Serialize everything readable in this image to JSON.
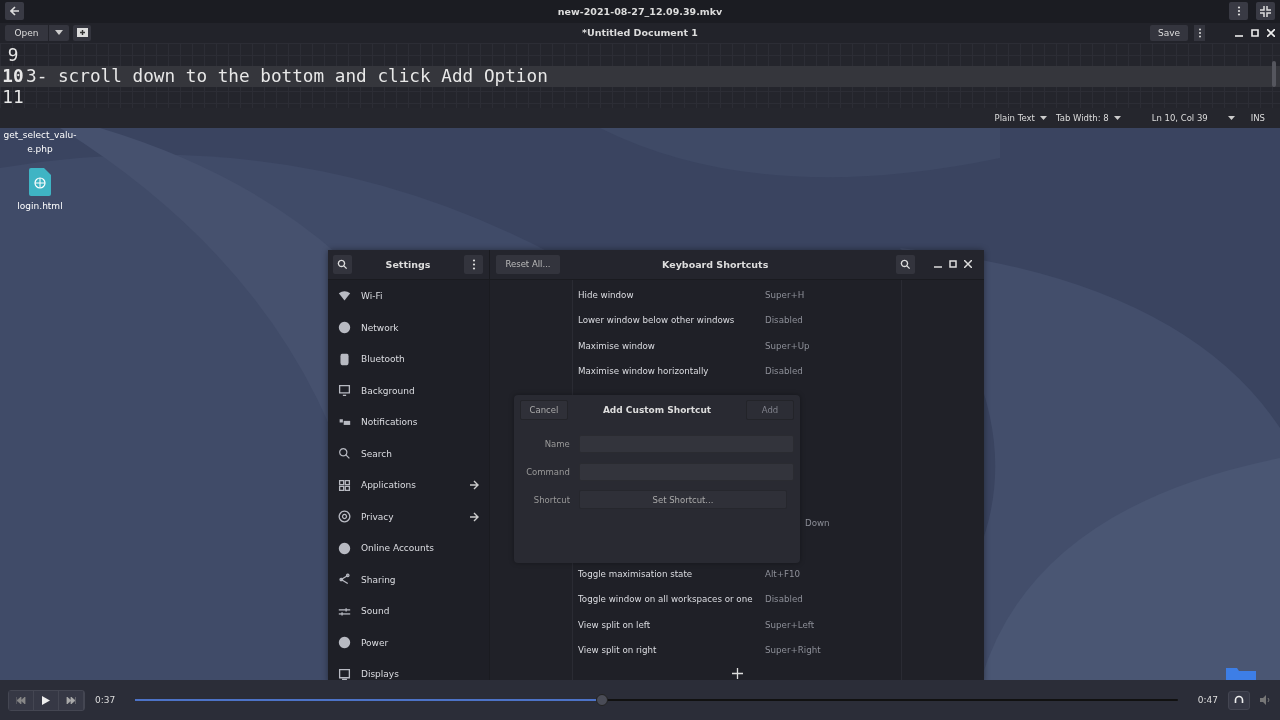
{
  "player": {
    "title": "new-2021-08-27_12.09.39.mkv",
    "current_time": "0:37",
    "total_time": "0:47",
    "level": 0.448
  },
  "editor": {
    "title": "*Untitled Document 1",
    "open_label": "Open",
    "save_label": "Save",
    "lines": [
      {
        "number": "9",
        "current": false
      },
      {
        "number": "10",
        "text": "3- scroll down to the bottom and click Add Option",
        "current": true
      },
      {
        "number": "11",
        "current": false
      }
    ],
    "status": {
      "language": "Plain Text",
      "tab_width": "Tab Width: 8",
      "position": "Ln 10, Col 39",
      "mode": "INS"
    }
  },
  "desktop_icons": [
    {
      "label": "get_select_valu-\ne.php",
      "kind": "text"
    },
    {
      "label": "login.html",
      "kind": "web"
    }
  ],
  "settings": {
    "title": "Settings",
    "reset_label": "Reset All...",
    "panel_title": "Keyboard Shortcuts",
    "sidebar": [
      {
        "label": "Wi-Fi",
        "submenu": false
      },
      {
        "label": "Network",
        "submenu": false
      },
      {
        "label": "Bluetooth",
        "submenu": false
      },
      {
        "label": "Background",
        "submenu": false
      },
      {
        "label": "Notifications",
        "submenu": false
      },
      {
        "label": "Search",
        "submenu": false
      },
      {
        "label": "Applications",
        "submenu": true
      },
      {
        "label": "Privacy",
        "submenu": true
      },
      {
        "label": "Online Accounts",
        "submenu": false
      },
      {
        "label": "Sharing",
        "submenu": false
      },
      {
        "label": "Sound",
        "submenu": false
      },
      {
        "label": "Power",
        "submenu": false
      },
      {
        "label": "Displays",
        "submenu": false
      }
    ],
    "shortcuts": [
      {
        "kind": "row",
        "name": "Hide window",
        "keys": "Super+H"
      },
      {
        "kind": "row",
        "name": "Lower window below other windows",
        "keys": "Disabled"
      },
      {
        "kind": "row",
        "name": "Maximise window",
        "keys": "Super+Up"
      },
      {
        "kind": "row",
        "name": "Maximise window horizontally",
        "keys": "Disabled"
      },
      {
        "kind": "covered"
      },
      {
        "kind": "covered"
      },
      {
        "kind": "covered"
      },
      {
        "kind": "covered"
      },
      {
        "kind": "covered"
      },
      {
        "kind": "covered",
        "keys": "Down"
      },
      {
        "kind": "covered"
      },
      {
        "kind": "row",
        "name": "Toggle maximisation state",
        "keys": "Alt+F10"
      },
      {
        "kind": "row",
        "name": "Toggle window on all workspaces or one",
        "keys": "Disabled"
      },
      {
        "kind": "row",
        "name": "View split on left",
        "keys": "Super+Left"
      },
      {
        "kind": "row",
        "name": "View split on right",
        "keys": "Super+Right"
      }
    ],
    "dialog": {
      "title": "Add Custom Shortcut",
      "cancel_label": "Cancel",
      "add_label": "Add",
      "add_disabled": true,
      "fields": [
        {
          "label": "Name",
          "kind": "entry"
        },
        {
          "label": "Command",
          "kind": "entry"
        },
        {
          "label": "Shortcut",
          "kind": "button",
          "value": "Set Shortcut..."
        }
      ]
    }
  }
}
